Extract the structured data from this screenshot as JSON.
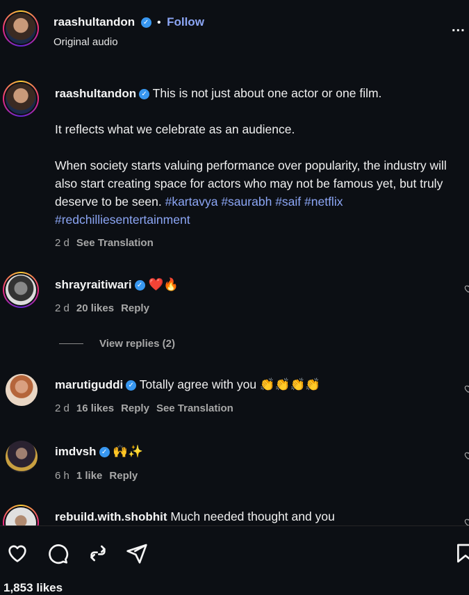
{
  "header": {
    "username": "raashultandon",
    "separator": "•",
    "follow_label": "Follow",
    "audio": "Original audio",
    "more_label": "..."
  },
  "caption": {
    "username": "raashultandon",
    "line1": "This is not just about one actor or one film.",
    "para2": "It reflects what we celebrate as an audience.",
    "para3": "When society starts valuing performance over popularity, the industry will also start creating space for actors who may not be famous yet, but truly deserve to be seen.",
    "hashtags_line1": "#kartavya #saurabh",
    "hashtags_line2": "#saif #netflix #redchilliesentertainment",
    "time": "2 d",
    "see_translation": "See Translation"
  },
  "comments": [
    {
      "username": "shrayraitiwari",
      "text": "❤️🔥",
      "time": "2 d",
      "likes": "20 likes",
      "reply": "Reply",
      "view_replies": "View replies (2)"
    },
    {
      "username": "marutiguddi",
      "text": "Totally agree with you 👏👏👏👏",
      "time": "2 d",
      "likes": "16 likes",
      "reply": "Reply",
      "see_translation": "See Translation"
    },
    {
      "username": "imdvsh",
      "text": "🙌✨",
      "time": "6 h",
      "likes": "1 like",
      "reply": "Reply"
    },
    {
      "username": "rebuild.with.shobhit",
      "text": "Much needed thought and you"
    }
  ],
  "actions": {
    "like_icon": "heart-icon",
    "comment_icon": "comment-icon",
    "share_icon": "repost-icon",
    "send_icon": "send-icon",
    "save_icon": "bookmark-icon"
  },
  "likes_count": "1,853 likes"
}
